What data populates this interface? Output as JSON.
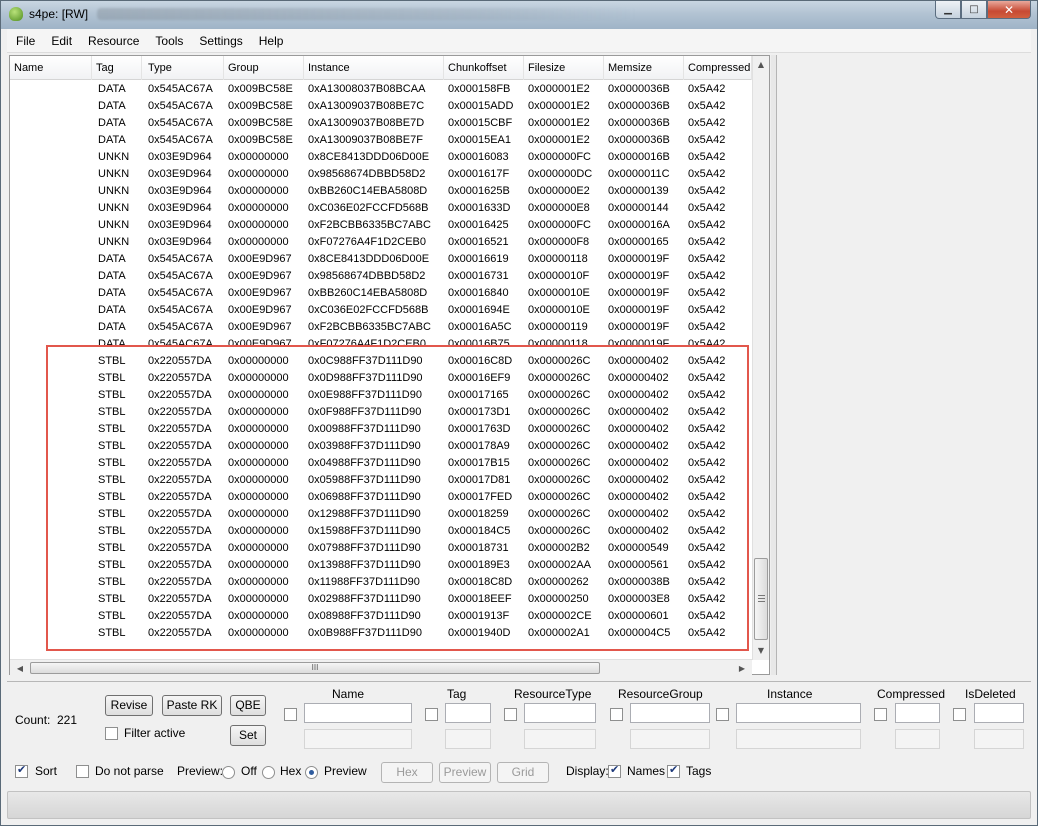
{
  "window": {
    "title": "s4pe: [RW]"
  },
  "menu": [
    "File",
    "Edit",
    "Resource",
    "Tools",
    "Settings",
    "Help"
  ],
  "columns": [
    "Name",
    "Tag",
    "Type",
    "Group",
    "Instance",
    "Chunkoffset",
    "Filesize",
    "Memsize",
    "Compressed"
  ],
  "rows": [
    [
      "",
      "DATA",
      "0x545AC67A",
      "0x009BC58E",
      "0xA13008037B08BCAA",
      "0x000158FB",
      "0x000001E2",
      "0x0000036B",
      "0x5A42"
    ],
    [
      "",
      "DATA",
      "0x545AC67A",
      "0x009BC58E",
      "0xA13009037B08BE7C",
      "0x00015ADD",
      "0x000001E2",
      "0x0000036B",
      "0x5A42"
    ],
    [
      "",
      "DATA",
      "0x545AC67A",
      "0x009BC58E",
      "0xA13009037B08BE7D",
      "0x00015CBF",
      "0x000001E2",
      "0x0000036B",
      "0x5A42"
    ],
    [
      "",
      "DATA",
      "0x545AC67A",
      "0x009BC58E",
      "0xA13009037B08BE7F",
      "0x00015EA1",
      "0x000001E2",
      "0x0000036B",
      "0x5A42"
    ],
    [
      "",
      "UNKN",
      "0x03E9D964",
      "0x00000000",
      "0x8CE8413DDD06D00E",
      "0x00016083",
      "0x000000FC",
      "0x0000016B",
      "0x5A42"
    ],
    [
      "",
      "UNKN",
      "0x03E9D964",
      "0x00000000",
      "0x98568674DBBD58D2",
      "0x0001617F",
      "0x000000DC",
      "0x0000011C",
      "0x5A42"
    ],
    [
      "",
      "UNKN",
      "0x03E9D964",
      "0x00000000",
      "0xBB260C14EBA5808D",
      "0x0001625B",
      "0x000000E2",
      "0x00000139",
      "0x5A42"
    ],
    [
      "",
      "UNKN",
      "0x03E9D964",
      "0x00000000",
      "0xC036E02FCCFD568B",
      "0x0001633D",
      "0x000000E8",
      "0x00000144",
      "0x5A42"
    ],
    [
      "",
      "UNKN",
      "0x03E9D964",
      "0x00000000",
      "0xF2BCBB6335BC7ABC",
      "0x00016425",
      "0x000000FC",
      "0x0000016A",
      "0x5A42"
    ],
    [
      "",
      "UNKN",
      "0x03E9D964",
      "0x00000000",
      "0xF07276A4F1D2CEB0",
      "0x00016521",
      "0x000000F8",
      "0x00000165",
      "0x5A42"
    ],
    [
      "",
      "DATA",
      "0x545AC67A",
      "0x00E9D967",
      "0x8CE8413DDD06D00E",
      "0x00016619",
      "0x00000118",
      "0x0000019F",
      "0x5A42"
    ],
    [
      "",
      "DATA",
      "0x545AC67A",
      "0x00E9D967",
      "0x98568674DBBD58D2",
      "0x00016731",
      "0x0000010F",
      "0x0000019F",
      "0x5A42"
    ],
    [
      "",
      "DATA",
      "0x545AC67A",
      "0x00E9D967",
      "0xBB260C14EBA5808D",
      "0x00016840",
      "0x0000010E",
      "0x0000019F",
      "0x5A42"
    ],
    [
      "",
      "DATA",
      "0x545AC67A",
      "0x00E9D967",
      "0xC036E02FCCFD568B",
      "0x0001694E",
      "0x0000010E",
      "0x0000019F",
      "0x5A42"
    ],
    [
      "",
      "DATA",
      "0x545AC67A",
      "0x00E9D967",
      "0xF2BCBB6335BC7ABC",
      "0x00016A5C",
      "0x00000119",
      "0x0000019F",
      "0x5A42"
    ],
    [
      "",
      "DATA",
      "0x545AC67A",
      "0x00E9D967",
      "0xF07276A4F1D2CEB0",
      "0x00016B75",
      "0x00000118",
      "0x0000019F",
      "0x5A42"
    ],
    [
      "",
      "STBL",
      "0x220557DA",
      "0x00000000",
      "0x0C988FF37D111D90",
      "0x00016C8D",
      "0x0000026C",
      "0x00000402",
      "0x5A42"
    ],
    [
      "",
      "STBL",
      "0x220557DA",
      "0x00000000",
      "0x0D988FF37D111D90",
      "0x00016EF9",
      "0x0000026C",
      "0x00000402",
      "0x5A42"
    ],
    [
      "",
      "STBL",
      "0x220557DA",
      "0x00000000",
      "0x0E988FF37D111D90",
      "0x00017165",
      "0x0000026C",
      "0x00000402",
      "0x5A42"
    ],
    [
      "",
      "STBL",
      "0x220557DA",
      "0x00000000",
      "0x0F988FF37D111D90",
      "0x000173D1",
      "0x0000026C",
      "0x00000402",
      "0x5A42"
    ],
    [
      "",
      "STBL",
      "0x220557DA",
      "0x00000000",
      "0x00988FF37D111D90",
      "0x0001763D",
      "0x0000026C",
      "0x00000402",
      "0x5A42"
    ],
    [
      "",
      "STBL",
      "0x220557DA",
      "0x00000000",
      "0x03988FF37D111D90",
      "0x000178A9",
      "0x0000026C",
      "0x00000402",
      "0x5A42"
    ],
    [
      "",
      "STBL",
      "0x220557DA",
      "0x00000000",
      "0x04988FF37D111D90",
      "0x00017B15",
      "0x0000026C",
      "0x00000402",
      "0x5A42"
    ],
    [
      "",
      "STBL",
      "0x220557DA",
      "0x00000000",
      "0x05988FF37D111D90",
      "0x00017D81",
      "0x0000026C",
      "0x00000402",
      "0x5A42"
    ],
    [
      "",
      "STBL",
      "0x220557DA",
      "0x00000000",
      "0x06988FF37D111D90",
      "0x00017FED",
      "0x0000026C",
      "0x00000402",
      "0x5A42"
    ],
    [
      "",
      "STBL",
      "0x220557DA",
      "0x00000000",
      "0x12988FF37D111D90",
      "0x00018259",
      "0x0000026C",
      "0x00000402",
      "0x5A42"
    ],
    [
      "",
      "STBL",
      "0x220557DA",
      "0x00000000",
      "0x15988FF37D111D90",
      "0x000184C5",
      "0x0000026C",
      "0x00000402",
      "0x5A42"
    ],
    [
      "",
      "STBL",
      "0x220557DA",
      "0x00000000",
      "0x07988FF37D111D90",
      "0x00018731",
      "0x000002B2",
      "0x00000549",
      "0x5A42"
    ],
    [
      "",
      "STBL",
      "0x220557DA",
      "0x00000000",
      "0x13988FF37D111D90",
      "0x000189E3",
      "0x000002AA",
      "0x00000561",
      "0x5A42"
    ],
    [
      "",
      "STBL",
      "0x220557DA",
      "0x00000000",
      "0x11988FF37D111D90",
      "0x00018C8D",
      "0x00000262",
      "0x0000038B",
      "0x5A42"
    ],
    [
      "",
      "STBL",
      "0x220557DA",
      "0x00000000",
      "0x02988FF37D111D90",
      "0x00018EEF",
      "0x00000250",
      "0x000003E8",
      "0x5A42"
    ],
    [
      "",
      "STBL",
      "0x220557DA",
      "0x00000000",
      "0x08988FF37D111D90",
      "0x0001913F",
      "0x000002CE",
      "0x00000601",
      "0x5A42"
    ],
    [
      "",
      "STBL",
      "0x220557DA",
      "0x00000000",
      "0x0B988FF37D111D90",
      "0x0001940D",
      "0x000002A1",
      "0x000004C5",
      "0x5A42"
    ]
  ],
  "filter": {
    "count_label": "Count:",
    "count_value": "221",
    "revise": "Revise",
    "paste_rk": "Paste RK",
    "qbe": "QBE",
    "filter_active": "Filter active",
    "set": "Set",
    "fields": [
      "Name",
      "Tag",
      "ResourceType",
      "ResourceGroup",
      "Instance",
      "Compressed",
      "IsDeleted"
    ]
  },
  "options": {
    "sort": "Sort",
    "do_not_parse": "Do not parse",
    "preview_label": "Preview:",
    "off": "Off",
    "hex": "Hex",
    "preview": "Preview",
    "hex_btn": "Hex",
    "preview_btn": "Preview",
    "grid_btn": "Grid",
    "display_label": "Display:",
    "names": "Names",
    "tags": "Tags"
  },
  "scroll_glyph": "III",
  "colors": {
    "highlight": "#e2574c"
  }
}
